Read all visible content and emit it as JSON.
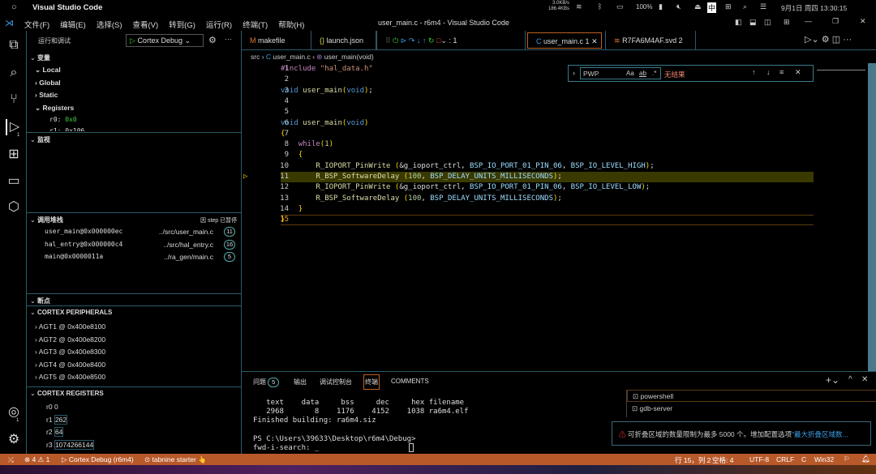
{
  "system": {
    "app_title": "Visual Studio Code",
    "net_up": "3.0KB/s",
    "net_down": "186.4KBs",
    "battery": "100%",
    "ime": "中",
    "datetime": "9月1日 周四 13:30:15"
  },
  "menu": {
    "items": [
      "文件(F)",
      "编辑(E)",
      "选择(S)",
      "查看(V)",
      "转到(G)",
      "运行(R)",
      "终端(T)",
      "帮助(H)"
    ],
    "window_title": "user_main.c - r6m4 - Visual Studio Code"
  },
  "activity": {
    "debug_badge": "1",
    "accounts_badge": "1"
  },
  "sidebar": {
    "title": "运行和调试",
    "config": "Cortex Debug",
    "variables": {
      "title": "变量",
      "local": "Local",
      "global": "Global",
      "static": "Static",
      "registers": "Registers",
      "r0_name": "r0:",
      "r0_value": "0x0",
      "r1_partial": "r1: 0x106"
    },
    "watch": {
      "title": "监视"
    },
    "callstack": {
      "title": "调用堆栈",
      "status": "因 step 已暂停",
      "frames": [
        {
          "name": "user_main@0x000000ec",
          "file": "../src/user_main.c",
          "line": "11"
        },
        {
          "name": "hal_entry@0x000000c4",
          "file": "../src/hal_entry.c",
          "line": "16"
        },
        {
          "name": "main@0x0000011a",
          "file": "../ra_gen/main.c",
          "line": "5"
        }
      ]
    },
    "breakpoints": {
      "title": "断点"
    },
    "peripherals": {
      "title": "CORTEX PERIPHERALS",
      "items": [
        "AGT1 @ 0x400e8100",
        "AGT2 @ 0x400e8200",
        "AGT3 @ 0x400e8300",
        "AGT4 @ 0x400e8400",
        "AGT5 @ 0x400e8500"
      ]
    },
    "registers": {
      "title": "CORTEX REGISTERS",
      "items": [
        {
          "name": "r0",
          "value": "0"
        },
        {
          "name": "r1",
          "value": "262"
        },
        {
          "name": "r2",
          "value": "64"
        },
        {
          "name": "r3",
          "value": "1074266144"
        }
      ]
    }
  },
  "tabs": [
    {
      "label": "makefile",
      "icon": "M"
    },
    {
      "label": "launch.json",
      "icon": "{}"
    },
    {
      "label": ": 1",
      "icon": ""
    },
    {
      "label": "user_main.c 1",
      "icon": "C"
    },
    {
      "label": "R7FA6M4AF.svd 2",
      "icon": "rss"
    }
  ],
  "breadcrumb": [
    "src",
    "user_main.c",
    "user_main(void)"
  ],
  "find": {
    "query": "PWP",
    "case": "Aa",
    "word": "ab",
    "regex": ".*",
    "result": "无结果"
  },
  "code": {
    "current_line": 11,
    "lines": [
      "#include \"hal_data.h\"",
      "",
      "void user_main(void);",
      "",
      "",
      "void user_main(void)",
      "{",
      "    while(1)",
      "    {",
      "        R_IOPORT_PinWrite (&g_ioport_ctrl, BSP_IO_PORT_01_PIN_06, BSP_IO_LEVEL_HIGH);",
      "        R_BSP_SoftwareDelay (100, BSP_DELAY_UNITS_MILLISECONDS);",
      "        R_IOPORT_PinWrite (&g_ioport_ctrl, BSP_IO_PORT_01_PIN_06, BSP_IO_LEVEL_LOW);",
      "        R_BSP_SoftwareDelay (100, BSP_DELAY_UNITS_MILLISECONDS);",
      "    }",
      "}"
    ]
  },
  "panel": {
    "tabs": [
      "问题",
      "输出",
      "调试控制台",
      "终端",
      "COMMENTS"
    ],
    "problems_count": "5",
    "active_tab": "终端",
    "terminal": [
      "   text    data     bss     dec     hex filename",
      "   2968       8    1176    4152    1038 ra6m4.elf",
      "Finished building: ra6m4.siz",
      "",
      "PS C:\\Users\\39633\\Desktop\\r6m4\\Debug>",
      "fwd-i-search: _"
    ],
    "terminals": [
      "powershell",
      "gdb-server"
    ]
  },
  "notification": {
    "text": "可折叠区域的数量限制为最多 5000 个。增加配置选项",
    "link": "\"最大折叠区域数..."
  },
  "status": {
    "errors": "4",
    "warnings": "1",
    "debug": "Cortex Debug (r6m4)",
    "tabnine": "tabnine starter",
    "position": "行 15，列 2",
    "spaces": "空格: 4",
    "encoding": "UTF-8",
    "eol": "CRLF",
    "lang": "C",
    "platform": "Win32"
  },
  "colors": {
    "status_bar": "#b8592a",
    "current_line": "#3a3a00",
    "accent": "#2a5a6a"
  }
}
